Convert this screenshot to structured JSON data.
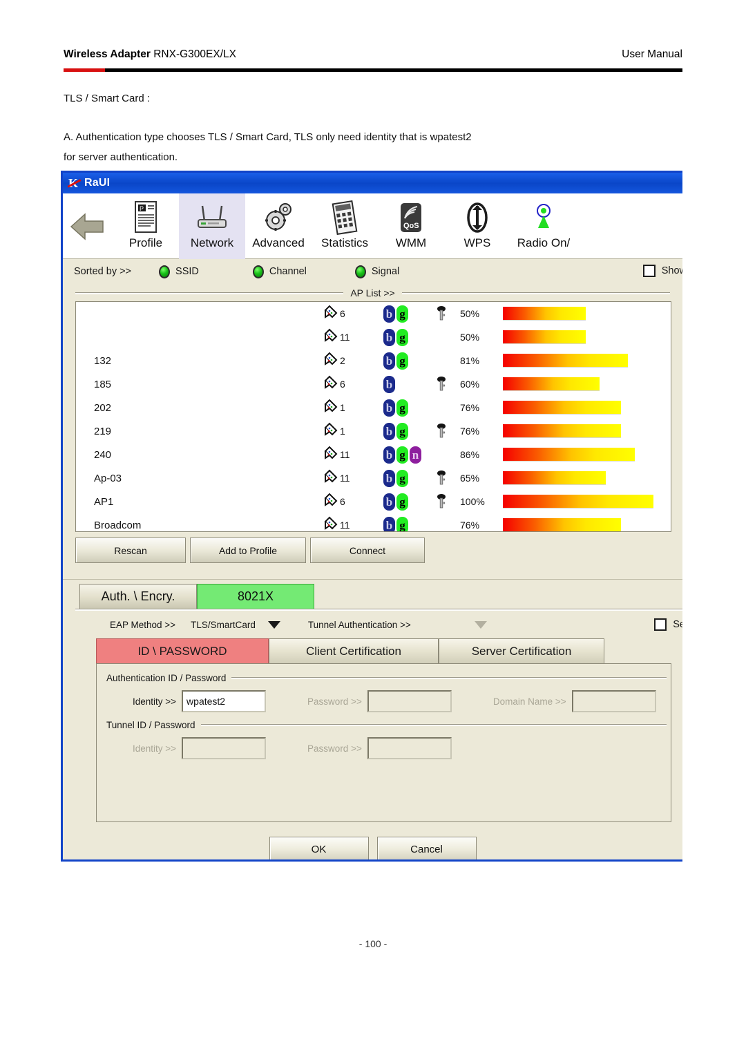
{
  "document": {
    "header_left_bold": "Wireless Adapter",
    "header_left_rest": " RNX-G300EX/LX",
    "header_right": "User Manual",
    "line1": "TLS / Smart Card :",
    "line2": "A. Authentication type chooses TLS / Smart Card, TLS only need identity that is wpatest2",
    "line3": "for server authentication.",
    "page_number": "- 100 -",
    "accent_red": "#d81010"
  },
  "window": {
    "title": "RaUI",
    "titlebar_color": "#0a46c8",
    "border_color": "#1244c8",
    "body_color": "#ece9d8"
  },
  "toolbar": {
    "back_icon": "back-arrow-icon",
    "items": [
      {
        "label": "Profile",
        "icon": "profile-icon",
        "active": false
      },
      {
        "label": "Network",
        "icon": "router-icon",
        "active": true
      },
      {
        "label": "Advanced",
        "icon": "gears-icon",
        "active": false
      },
      {
        "label": "Statistics",
        "icon": "statistics-icon",
        "active": false
      },
      {
        "label": "WMM",
        "icon": "qos-icon",
        "active": false
      },
      {
        "label": "WPS",
        "icon": "wps-icon",
        "active": false
      },
      {
        "label": "Radio On/",
        "icon": "radio-antenna-icon",
        "active": false
      }
    ]
  },
  "sort_row": {
    "label": "Sorted by >>",
    "options": [
      "SSID",
      "Channel",
      "Signal"
    ],
    "show_checkbox_label": "Show",
    "show_checked": false
  },
  "ap_list": {
    "caption": "AP List >>",
    "rows": [
      {
        "ssid": "",
        "channel": "6",
        "modes": [
          "b",
          "g"
        ],
        "secured": true,
        "signal": "50%",
        "signal_value": 50
      },
      {
        "ssid": "",
        "channel": "11",
        "modes": [
          "b",
          "g"
        ],
        "secured": false,
        "signal": "50%",
        "signal_value": 50
      },
      {
        "ssid": "132",
        "channel": "2",
        "modes": [
          "b",
          "g"
        ],
        "secured": false,
        "signal": "81%",
        "signal_value": 81
      },
      {
        "ssid": "185",
        "channel": "6",
        "modes": [
          "b"
        ],
        "secured": true,
        "signal": "60%",
        "signal_value": 60
      },
      {
        "ssid": "202",
        "channel": "1",
        "modes": [
          "b",
          "g"
        ],
        "secured": false,
        "signal": "76%",
        "signal_value": 76
      },
      {
        "ssid": "219",
        "channel": "1",
        "modes": [
          "b",
          "g"
        ],
        "secured": true,
        "signal": "76%",
        "signal_value": 76
      },
      {
        "ssid": "240",
        "channel": "11",
        "modes": [
          "b",
          "g",
          "n"
        ],
        "secured": false,
        "signal": "86%",
        "signal_value": 86
      },
      {
        "ssid": "Ap-03",
        "channel": "11",
        "modes": [
          "b",
          "g"
        ],
        "secured": true,
        "signal": "65%",
        "signal_value": 65
      },
      {
        "ssid": "AP1",
        "channel": "6",
        "modes": [
          "b",
          "g"
        ],
        "secured": true,
        "signal": "100%",
        "signal_value": 100
      },
      {
        "ssid": "Broadcom",
        "channel": "11",
        "modes": [
          "b",
          "g"
        ],
        "secured": false,
        "signal": "76%",
        "signal_value": 76
      }
    ]
  },
  "action_buttons": {
    "rescan": "Rescan",
    "add_to_profile": "Add to Profile",
    "connect": "Connect"
  },
  "auth_section": {
    "tab_auth_encry": "Auth. \\ Encry.",
    "tab_8021x": "8021X",
    "tab_8021x_color": "#74ea74",
    "eap_method_label": "EAP Method >>",
    "eap_method_value": "TLS/SmartCard",
    "tunnel_auth_label": "Tunnel Authentication >>",
    "tunnel_auth_value": "",
    "session_checkbox_label": "Se",
    "session_checked": false,
    "subtabs": [
      {
        "label": "ID \\ PASSWORD",
        "active": true
      },
      {
        "label": "Client Certification",
        "active": false
      },
      {
        "label": "Server Certification",
        "active": false
      }
    ],
    "active_subtab_color": "#ef8080"
  },
  "form": {
    "group1_title": "Authentication ID / Password",
    "group1_identity_label": "Identity >>",
    "group1_identity_value": "wpatest2",
    "group1_password_label": "Password >>",
    "group1_password_value": "",
    "group1_domain_label": "Domain Name >>",
    "group1_domain_value": "",
    "group2_title": "Tunnel ID / Password",
    "group2_identity_label": "Identity >>",
    "group2_identity_value": "",
    "group2_password_label": "Password >>",
    "group2_password_value": ""
  },
  "dialog_buttons": {
    "ok": "OK",
    "cancel": "Cancel"
  }
}
